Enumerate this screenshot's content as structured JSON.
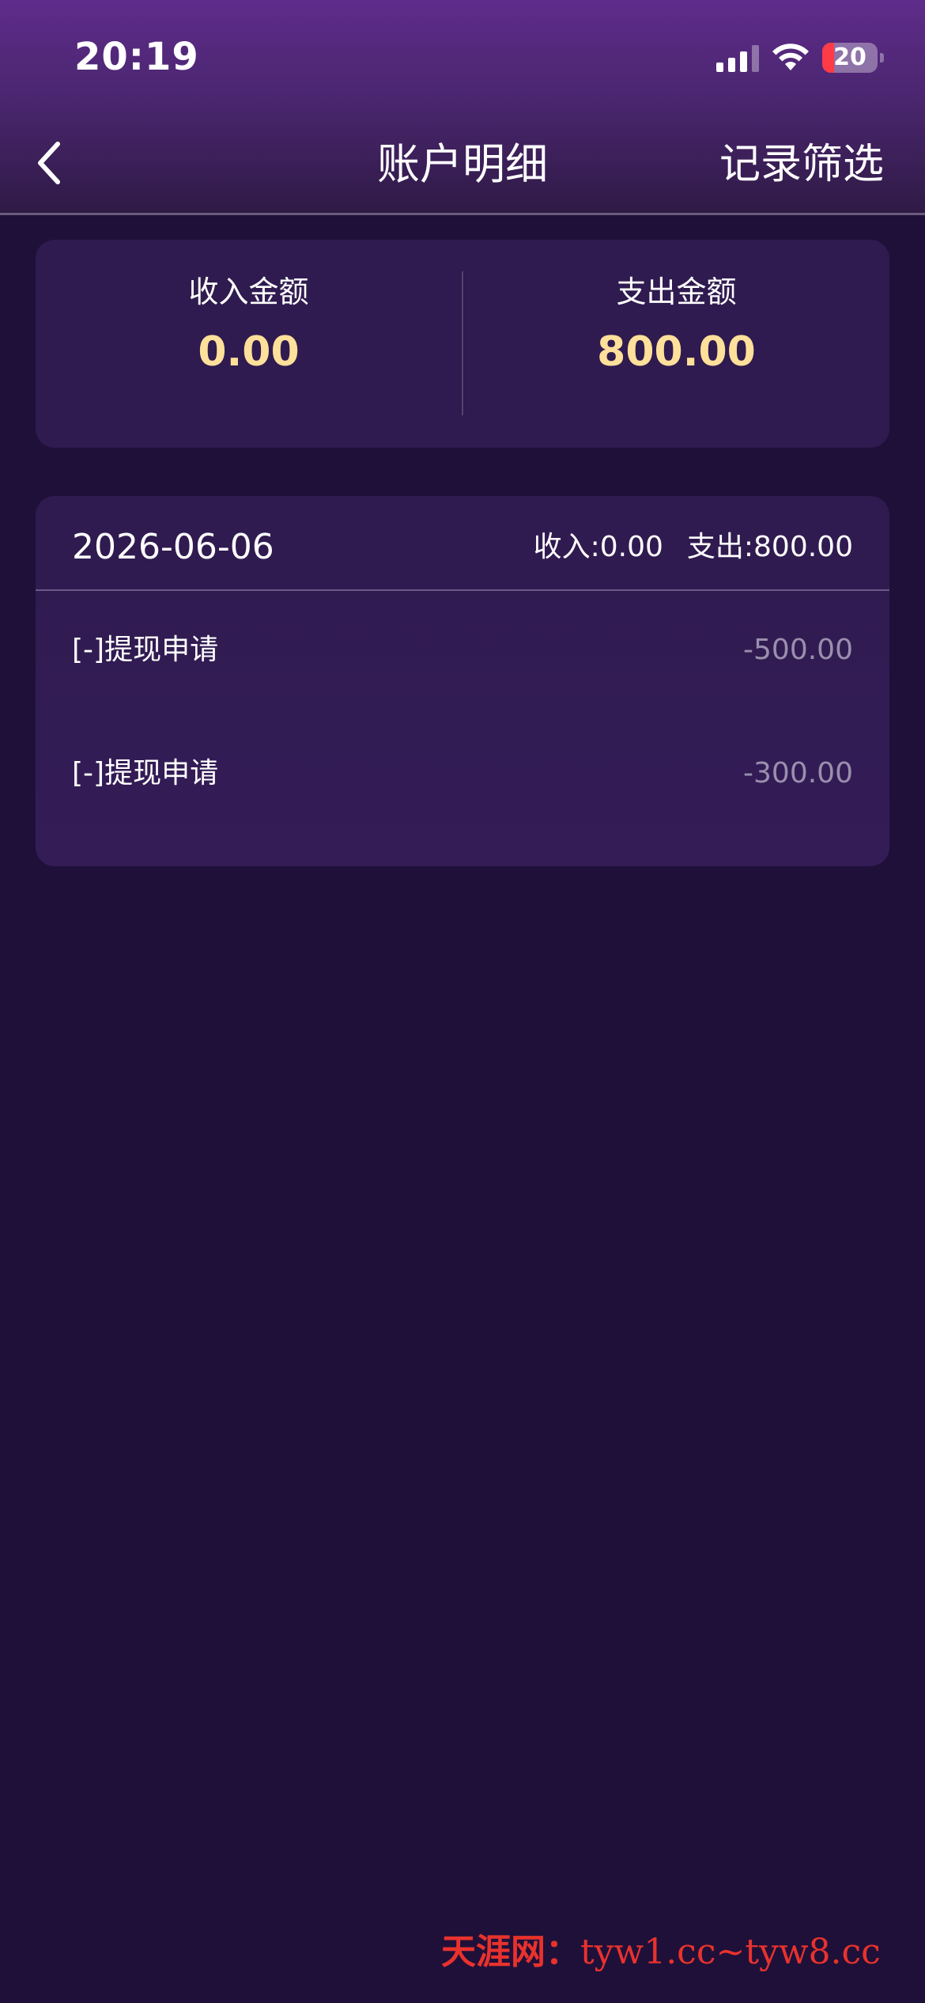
{
  "status_bar": {
    "time": "20:19",
    "battery": "20",
    "icons": [
      "signal-icon",
      "wifi-icon",
      "battery-icon"
    ],
    "battery_color": "#ff3b47"
  },
  "nav": {
    "back_icon": "chevron-left-icon",
    "title": "账户明细",
    "filter_label": "记录筛选"
  },
  "summary": {
    "income_label": "收入金额",
    "income_value": "0.00",
    "expense_label": "支出金额",
    "expense_value": "800.00",
    "value_color": "#ffe09a"
  },
  "day_group": {
    "date": "2026-06-06",
    "income_summary": "收入:0.00",
    "expense_summary": "支出:800.00",
    "records": [
      {
        "title": "[-]提现申请",
        "amount": "-500.00"
      },
      {
        "title": "[-]提现申请",
        "amount": "-300.00"
      }
    ]
  },
  "watermark": {
    "cn": "天涯网：",
    "url": "tyw1.cc~tyw8.cc"
  },
  "colors": {
    "background": "#1f1039",
    "card": "#2f1b4f",
    "header_top": "#5e2c8a",
    "amount_muted": "#9a8fad",
    "watermark": "#e8322d"
  }
}
